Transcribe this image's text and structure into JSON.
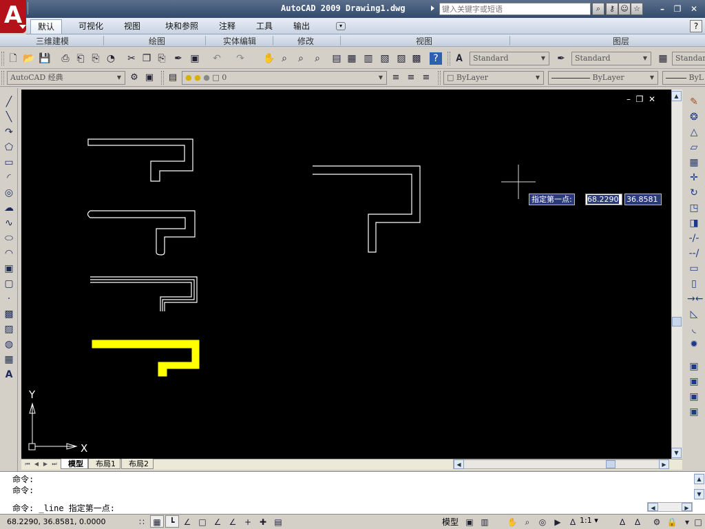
{
  "app": {
    "title": "AutoCAD 2009  Drawing1.dwg",
    "logo_letter": "A",
    "search_placeholder": "键入关键字或短语",
    "help_glyph": "?"
  },
  "ribbon": {
    "tabs": [
      {
        "label": "默认"
      },
      {
        "label": "可视化"
      },
      {
        "label": "视图"
      },
      {
        "label": "块和参照"
      },
      {
        "label": "注释"
      },
      {
        "label": "工具"
      },
      {
        "label": "输出"
      }
    ],
    "panels": [
      {
        "label": "三维建模"
      },
      {
        "label": "绘图"
      },
      {
        "label": "实体编辑"
      },
      {
        "label": "修改"
      },
      {
        "label": "视图"
      },
      {
        "label": "图层"
      }
    ]
  },
  "toolbar": {
    "text_style": "Standard",
    "dim_style": "Standard",
    "table_style": "Standar",
    "workspace": "AutoCAD 经典",
    "layer": "0",
    "color": "ByLayer",
    "linetype": "ByLayer",
    "lineweight": "ByL"
  },
  "layout_tabs": [
    {
      "label": "模型"
    },
    {
      "label": "布局1"
    },
    {
      "label": "布局2"
    }
  ],
  "command": {
    "lines": [
      "命令:",
      "命令:",
      "命令: _line 指定第一点:"
    ]
  },
  "dynamic_input": {
    "prompt": "指定第一点:",
    "x_value": "68.2290",
    "y_value": "36.8581"
  },
  "ucs": {
    "x_label": "X",
    "y_label": "Y"
  },
  "status": {
    "coordinates": "68.2290, 36.8581, 0.0000",
    "model_label": "模型",
    "scale": "1:1"
  },
  "colors": {
    "canvas": "#000000",
    "entity": "#ffffff",
    "selected_entity": "#ffff00",
    "title_bar": "#334a6b",
    "logo": "#b3121a"
  }
}
